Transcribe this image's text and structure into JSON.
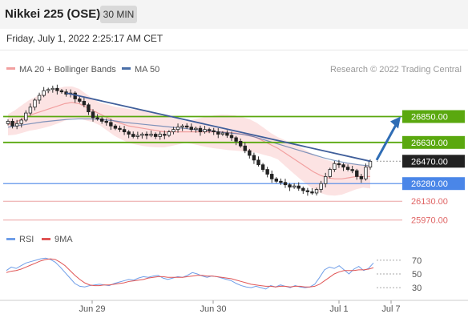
{
  "header": {
    "title": "Nikkei 225 (OSE)",
    "timeframe": "30 MIN"
  },
  "timestamp": "Friday, July 1, 2022 2:25:17 AM CET",
  "chart_data": {
    "type": "candlestick",
    "legend": [
      {
        "label": "MA 20 + Bollinger Bands",
        "color": "#f2a0a0"
      },
      {
        "label": "MA 50",
        "color": "#4a6fa8"
      }
    ],
    "source": "Research © 2022 Trading Central",
    "price_range": [
      25900,
      27160
    ],
    "x_ticks": [
      "Jun 29",
      "Jun 30",
      "Jul 1",
      "Jul 7"
    ],
    "levels": [
      {
        "value": 26850,
        "label": "26850.00",
        "kind": "resistance",
        "color": "#5aa80f"
      },
      {
        "value": 26630,
        "label": "26630.00",
        "kind": "resistance",
        "color": "#5aa80f"
      },
      {
        "value": 26470,
        "label": "26470.00",
        "kind": "last",
        "color": "#222222"
      },
      {
        "value": 26280,
        "label": "26280.00",
        "kind": "pivot",
        "color": "#4a86e8"
      },
      {
        "value": 26130,
        "label": "26130.00",
        "kind": "support",
        "color": "#e06666"
      },
      {
        "value": 25970,
        "label": "25970.00",
        "kind": "support",
        "color": "#e06666"
      }
    ],
    "closes": [
      26810,
      26770,
      26790,
      26820,
      26880,
      26930,
      26990,
      27030,
      27070,
      27080,
      27090,
      27070,
      27060,
      27040,
      27050,
      27000,
      26980,
      26950,
      26890,
      26840,
      26830,
      26810,
      26800,
      26770,
      26750,
      26740,
      26720,
      26700,
      26680,
      26690,
      26700,
      26690,
      26700,
      26680,
      26700,
      26690,
      26720,
      26740,
      26760,
      26770,
      26760,
      26740,
      26750,
      26720,
      26740,
      26730,
      26720,
      26700,
      26710,
      26690,
      26670,
      26640,
      26600,
      26560,
      26520,
      26480,
      26440,
      26400,
      26360,
      26320,
      26300,
      26290,
      26270,
      26250,
      26260,
      26240,
      26220,
      26210,
      26200,
      26230,
      26280,
      26340,
      26400,
      26450,
      26440,
      26420,
      26400,
      26390,
      26340,
      26320,
      26420,
      26470
    ],
    "ma20": [
      26780,
      26800,
      26830,
      26860,
      26880,
      26900,
      26920,
      26940,
      26960,
      26970,
      26960,
      26930,
      26900,
      26870,
      26840,
      26810,
      26790,
      26770,
      26760,
      26750,
      26740,
      26730,
      26720,
      26720,
      26720,
      26720,
      26720,
      26720,
      26720,
      26720,
      26720,
      26715,
      26710,
      26700,
      26690,
      26670,
      26640,
      26610,
      26580,
      26540,
      26500,
      26460,
      26420,
      26380,
      26350,
      26330,
      26320,
      26320,
      26330,
      26340,
      26340,
      26340
    ],
    "ma50": [
      26760,
      26775,
      26790,
      26805,
      26815,
      26825,
      26830,
      26830,
      26825,
      26815,
      26800,
      26790,
      26780,
      26770,
      26760,
      26750,
      26740,
      26730,
      26720,
      26710,
      26700,
      26680,
      26650,
      26620,
      26590,
      26560,
      26530,
      26500,
      26475,
      26455,
      26440,
      26430
    ],
    "trend_line": {
      "from": 27050,
      "to": 26470
    },
    "projection": {
      "from": 26480,
      "to": 26850
    },
    "rsi": {
      "legend": [
        {
          "label": "RSI",
          "color": "#6f9ee8"
        },
        {
          "label": "9MA",
          "color": "#e05555"
        }
      ],
      "levels": [
        "70",
        "50",
        "30"
      ],
      "range": [
        15,
        85
      ],
      "rsi_values": [
        55,
        60,
        58,
        62,
        66,
        68,
        70,
        72,
        73,
        71,
        67,
        60,
        52,
        44,
        36,
        32,
        31,
        33,
        34,
        35,
        34,
        33,
        36,
        38,
        40,
        42,
        41,
        44,
        46,
        45,
        47,
        48,
        44,
        42,
        44,
        46,
        45,
        48,
        52,
        50,
        47,
        45,
        47,
        46,
        44,
        42,
        40,
        36,
        33,
        31,
        30,
        32,
        30,
        28,
        33,
        31,
        34,
        32,
        30,
        33,
        31,
        30,
        31,
        35,
        45,
        56,
        60,
        58,
        62,
        56,
        50,
        57,
        61,
        55,
        58,
        66
      ],
      "ma_values": [
        52,
        54,
        55,
        57,
        60,
        63,
        66,
        69,
        71,
        72,
        71,
        67,
        62,
        55,
        48,
        42,
        37,
        34,
        33,
        33,
        34,
        34,
        35,
        36,
        37,
        39,
        40,
        41,
        42,
        44,
        45,
        46,
        46,
        45,
        45,
        45,
        45,
        46,
        47,
        48,
        48,
        47,
        47,
        46,
        45,
        44,
        43,
        41,
        39,
        37,
        35,
        34,
        33,
        32,
        32,
        31,
        32,
        32,
        31,
        32,
        32,
        31,
        31,
        32,
        35,
        40,
        45,
        50,
        53,
        55,
        55,
        55,
        56,
        56,
        57,
        59
      ]
    }
  }
}
